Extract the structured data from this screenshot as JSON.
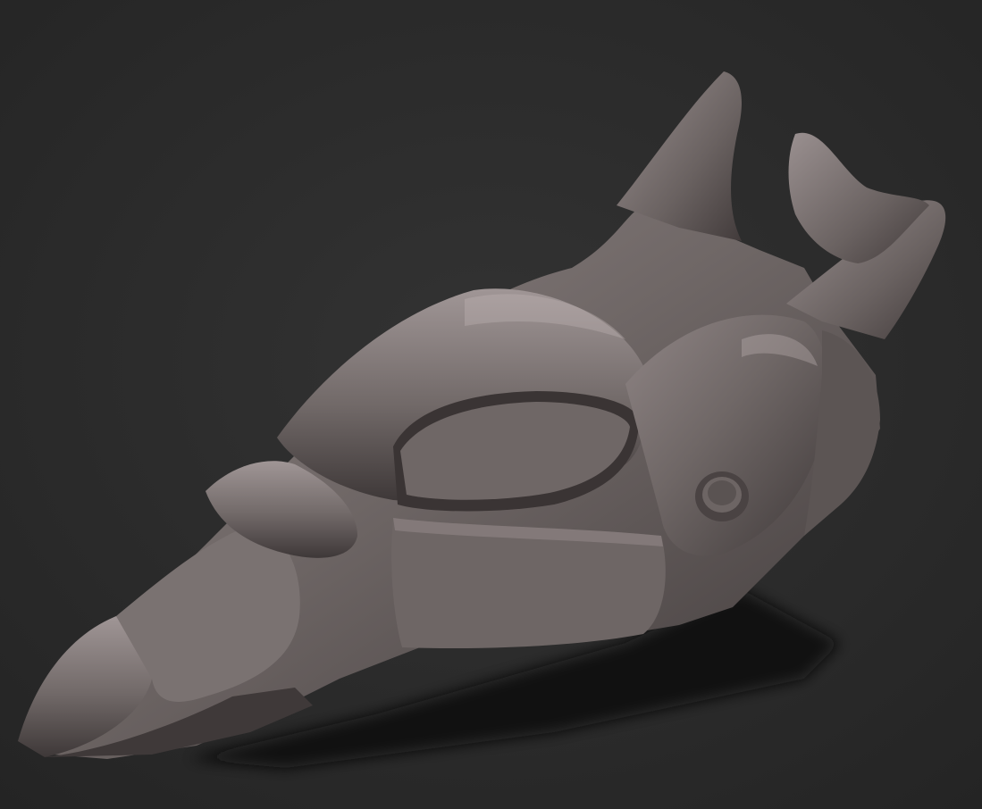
{
  "scene": {
    "subject": "sculpted-armored-head-model",
    "background_color": "#2f2f2f",
    "vignette_color": "#1f1f1f",
    "material_base_color": "#6d6563",
    "material_light_color": "#9a9090",
    "material_shadow_color": "#3b3535",
    "shadow_color": "#101010"
  }
}
